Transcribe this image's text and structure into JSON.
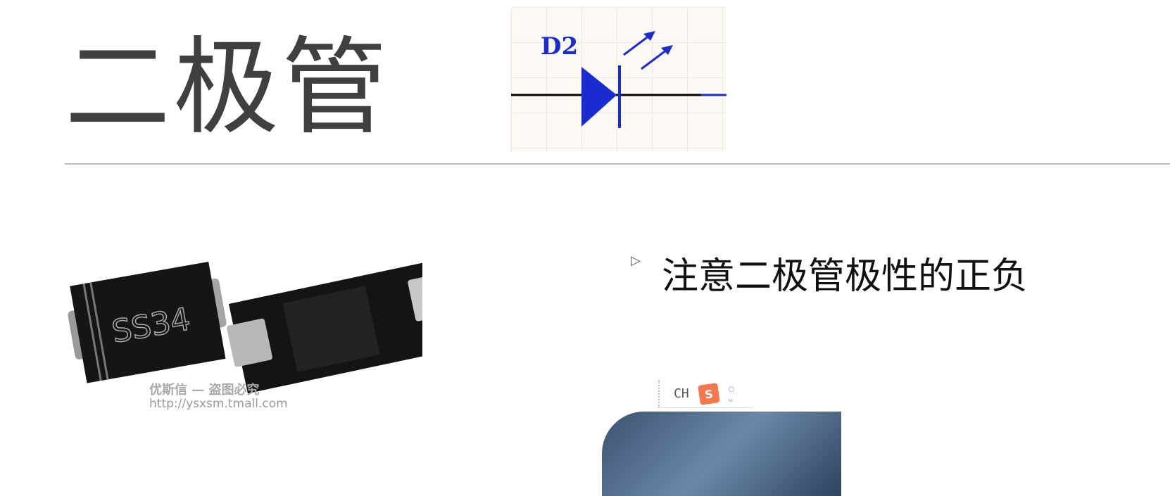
{
  "slide": {
    "title": "二极管",
    "bullet": "注意二极管极性的正负"
  },
  "schematic": {
    "ref": "D2",
    "color": "#1a2bd0"
  },
  "product_image": {
    "marking": "SS34",
    "watermark": "优斯信 — 盗图必究",
    "url": "http://ysxsm.tmall.com"
  },
  "ime": {
    "mode": "CH",
    "logo": "S"
  }
}
